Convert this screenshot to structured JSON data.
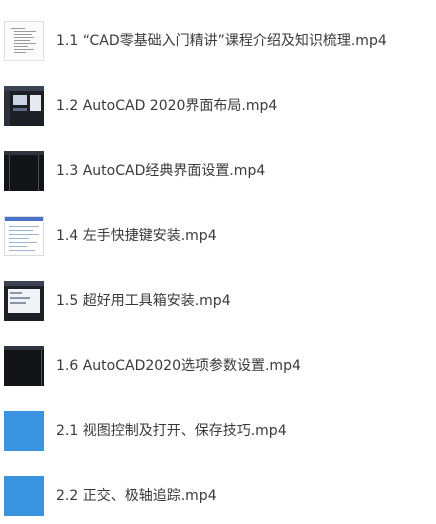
{
  "files": [
    {
      "name": "1.1 “CAD零基础入门精讲”课程介绍及知识梳理.mp4",
      "thumbnail": "document-outline-thumbnail"
    },
    {
      "name": "1.2 AutoCAD 2020界面布局.mp4",
      "thumbnail": "autocad-dark-ui-thumbnail"
    },
    {
      "name": "1.3 AutoCAD经典界面设置.mp4",
      "thumbnail": "autocad-classic-ui-thumbnail"
    },
    {
      "name": "1.4 左手快捷键安装.mp4",
      "thumbnail": "shortcut-table-thumbnail"
    },
    {
      "name": "1.5 超好用工具箱安装.mp4",
      "thumbnail": "toolbox-dialog-thumbnail"
    },
    {
      "name": "1.6 AutoCAD2020选项参数设置.mp4",
      "thumbnail": "autocad-black-canvas-thumbnail"
    },
    {
      "name": "2.1 视图控制及打开、保存技巧.mp4",
      "thumbnail": "video-placeholder-thumbnail"
    },
    {
      "name": "2.2 正交、极轴追踪.mp4",
      "thumbnail": "video-placeholder-thumbnail"
    }
  ],
  "colors": {
    "placeholder_blue": "#3a93e0",
    "text": "#3a3a3a"
  }
}
